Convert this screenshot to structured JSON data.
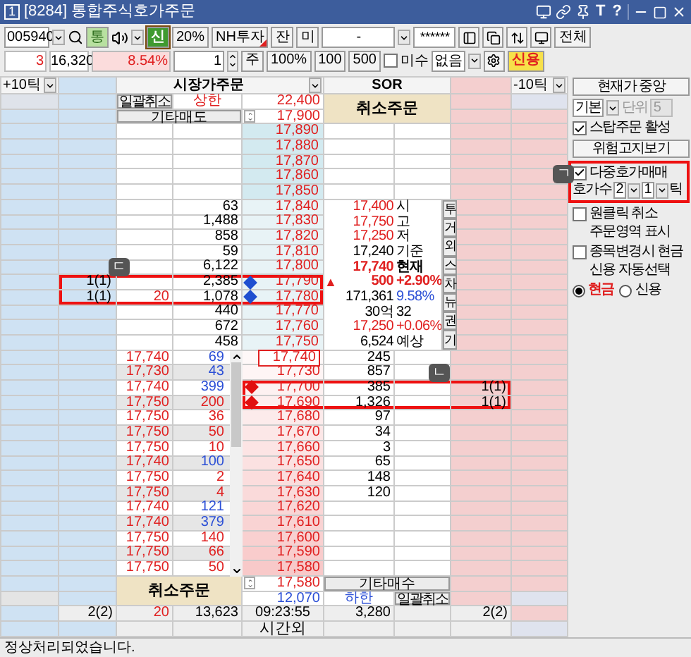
{
  "window": {
    "number": "1",
    "title": "[8284] 통합주식호가주문",
    "title_buttons": [
      "T",
      "?"
    ]
  },
  "toolbar": {
    "stock_code": "005940",
    "stock_toggle": {
      "label": "통",
      "on": true
    },
    "credit_toggle": {
      "label": "신",
      "selected": true
    },
    "rate": "20%",
    "broker": "NH투자",
    "balance_button": "잔",
    "unfilled_button": "미",
    "account": "-",
    "password": "******",
    "all_button": "전체",
    "change_count": "3",
    "price": "16,320",
    "change_rate": "8.54%",
    "quantity": "1",
    "unit": "주",
    "quick_buttons": [
      "100%",
      "100",
      "500"
    ],
    "misu": {
      "label": "미수",
      "checked": false
    },
    "condition": "없음",
    "credit_button": "신용"
  },
  "order_book": {
    "header": {
      "left_tick": "+10틱",
      "market_order": "시장가주문",
      "sor": "SOR",
      "right_tick": "-10틱"
    },
    "top": {
      "cancel_all": "일괄취소",
      "upper_label": "상한",
      "upper_price": "22,400",
      "cancel_order": "취소주문",
      "other_sell": "기타매도",
      "spin_price": "17,900"
    },
    "ask_callout": "ㄷ",
    "bid_callout": "ㄴ",
    "asks": [
      {
        "price": "17,890"
      },
      {
        "price": "17,880"
      },
      {
        "price": "17,870"
      },
      {
        "price": "17,860"
      },
      {
        "price": "17,850"
      },
      {
        "price": "17,840",
        "qty": "63"
      },
      {
        "price": "17,830",
        "qty": "1,488"
      },
      {
        "price": "17,820",
        "qty": "858"
      },
      {
        "price": "17,810",
        "qty": "59"
      },
      {
        "price": "17,800",
        "qty": "6,122"
      },
      {
        "price": "17,790",
        "qty": "2,385",
        "my_order": "1(1)",
        "marker": true,
        "highlighted": true
      },
      {
        "price": "17,780",
        "qty": "1,078",
        "my_order": "1(1)",
        "order_qty": "20",
        "marker": true,
        "highlighted": true
      },
      {
        "price": "17,770",
        "qty": "440"
      },
      {
        "price": "17,760",
        "qty": "672"
      },
      {
        "price": "17,750",
        "qty": "458"
      }
    ],
    "quote_info": {
      "lines": [
        {
          "kind": "price",
          "value": "17,400",
          "detail": "시"
        },
        {
          "kind": "price",
          "value": "17,750",
          "detail": "고"
        },
        {
          "kind": "price",
          "value": "17,250",
          "detail": "저"
        },
        {
          "kind": "plain",
          "value": "17,240",
          "detail": "기준"
        },
        {
          "kind": "current",
          "value": "17,740",
          "detail": "현재"
        },
        {
          "kind": "change",
          "arrow": "▲",
          "value": "500",
          "detail": "+2.90%"
        },
        {
          "kind": "volume",
          "value": "171,361",
          "detail": "9.58%"
        },
        {
          "kind": "plain",
          "value": "30억",
          "detail": "32"
        },
        {
          "kind": "expected_change",
          "value": "17,250",
          "detail": "+0.06%"
        },
        {
          "kind": "plain",
          "value": "6,524",
          "detail": "예상"
        }
      ],
      "tabs": [
        "투",
        "거",
        "외",
        "스",
        "차",
        "뉴",
        "권",
        "기"
      ]
    },
    "trades": [
      {
        "price": "17,740",
        "qty": "69",
        "color": "#2b4fd6"
      },
      {
        "price": "17,730",
        "qty": "43",
        "color": "#2b4fd6"
      },
      {
        "price": "17,740",
        "qty": "399",
        "color": "#2b4fd6"
      },
      {
        "price": "17,750",
        "qty": "200",
        "color": "#e02020"
      },
      {
        "price": "17,750",
        "qty": "36",
        "color": "#e02020"
      },
      {
        "price": "17,750",
        "qty": "50",
        "color": "#e02020"
      },
      {
        "price": "17,750",
        "qty": "10",
        "color": "#e02020"
      },
      {
        "price": "17,740",
        "qty": "100",
        "color": "#2b4fd6"
      },
      {
        "price": "17,750",
        "qty": "2",
        "color": "#e02020"
      },
      {
        "price": "17,750",
        "qty": "4",
        "color": "#e02020"
      },
      {
        "price": "17,740",
        "qty": "121",
        "color": "#2b4fd6"
      },
      {
        "price": "17,740",
        "qty": "379",
        "color": "#2b4fd6"
      },
      {
        "price": "17,750",
        "qty": "140",
        "color": "#e02020"
      },
      {
        "price": "17,750",
        "qty": "66",
        "color": "#e02020"
      },
      {
        "price": "17,750",
        "qty": "50",
        "color": "#e02020"
      }
    ],
    "bids": [
      {
        "price": "17,740",
        "qty": "245",
        "current": true
      },
      {
        "price": "17,730",
        "qty": "857"
      },
      {
        "price": "17,700",
        "qty": "385",
        "my_order": "1(1)",
        "marker": true,
        "highlighted": true
      },
      {
        "price": "17,690",
        "qty": "1,326",
        "my_order": "1(1)",
        "marker": true,
        "highlighted": true
      },
      {
        "price": "17,680",
        "qty": "97"
      },
      {
        "price": "17,670",
        "qty": "34"
      },
      {
        "price": "17,660",
        "qty": "3"
      },
      {
        "price": "17,650",
        "qty": "65"
      },
      {
        "price": "17,640",
        "qty": "148"
      },
      {
        "price": "17,630",
        "qty": "120"
      },
      {
        "price": "17,620"
      },
      {
        "price": "17,610"
      },
      {
        "price": "17,600"
      },
      {
        "price": "17,590"
      },
      {
        "price": "17,580"
      }
    ],
    "bottom": {
      "cancel_order": "취소주문",
      "spin_price": "17,580",
      "other_buy": "기타매수",
      "lower_price": "12,070",
      "lower_label": "하한",
      "cancel_all": "일괄취소"
    },
    "summary": {
      "my_ask_orders": "2(2)",
      "ask_order_qty": "20",
      "ask_total": "13,623",
      "time": "09:23:55",
      "bid_total": "3,280",
      "my_bid_orders": "2(2)",
      "after_hours": "시간외"
    }
  },
  "side_panel": {
    "center_button": "현재가 중앙",
    "mode": "기본",
    "unit": {
      "label": "단위",
      "value": "5",
      "disabled": true
    },
    "stop_order": {
      "label": "스탑주문 활성",
      "checked": true
    },
    "risk_button": "위험고지보기",
    "multi_order": {
      "label": "다중호가매매",
      "checked": true,
      "callout": "ㄱ"
    },
    "quote_count_label": "호가수",
    "quote_count": "2",
    "tick_count": "1",
    "tick_label": "틱",
    "one_click_cancel": {
      "label": "원클릭 취소",
      "checked": false
    },
    "one_click_note": "주문영역 표시",
    "cash_on_change": {
      "label": "종목변경시 현금",
      "checked": false
    },
    "cash_note": "신용 자동선택",
    "payment": [
      {
        "label": "현금",
        "selected": true
      },
      {
        "label": "신용",
        "selected": false
      }
    ]
  },
  "status_bar": {
    "message": "정상처리되었습니다."
  }
}
